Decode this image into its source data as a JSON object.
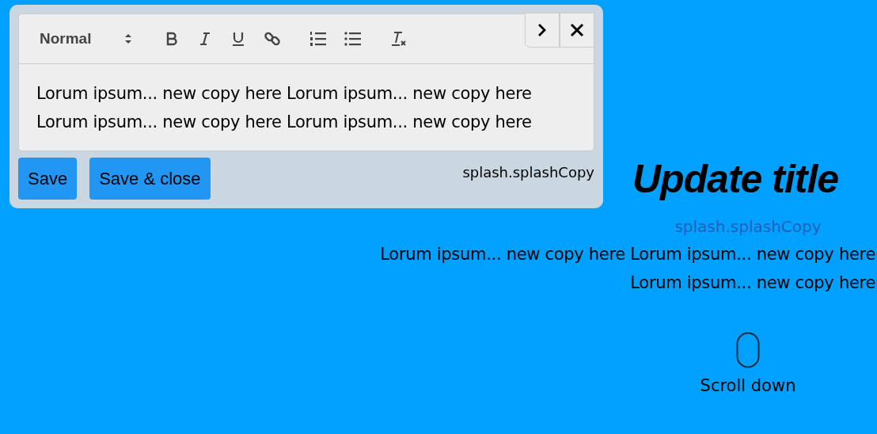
{
  "editor": {
    "format_select": "Normal",
    "toolbar": [
      {
        "kind": "bold"
      },
      {
        "kind": "italic"
      },
      {
        "kind": "underline"
      },
      {
        "kind": "link"
      },
      {
        "kind": "ordered-list"
      },
      {
        "kind": "bullet-list"
      },
      {
        "kind": "clear-format"
      }
    ],
    "lines": [
      "Lorum ipsum... new copy here Lorum ipsum... new copy here",
      "Lorum ipsum... new copy here Lorum ipsum... new copy here"
    ],
    "buttons": [
      "Save",
      "Save & close"
    ],
    "key": "splash.splashCopy"
  },
  "hero": {
    "title": "Update title",
    "key_label": "splash.splashCopy",
    "lines": [
      "Lorum ipsum... new copy here Lorum ipsum... new copy here",
      "Lorum ipsum... new copy here"
    ],
    "scroll_label": "Scroll down"
  }
}
